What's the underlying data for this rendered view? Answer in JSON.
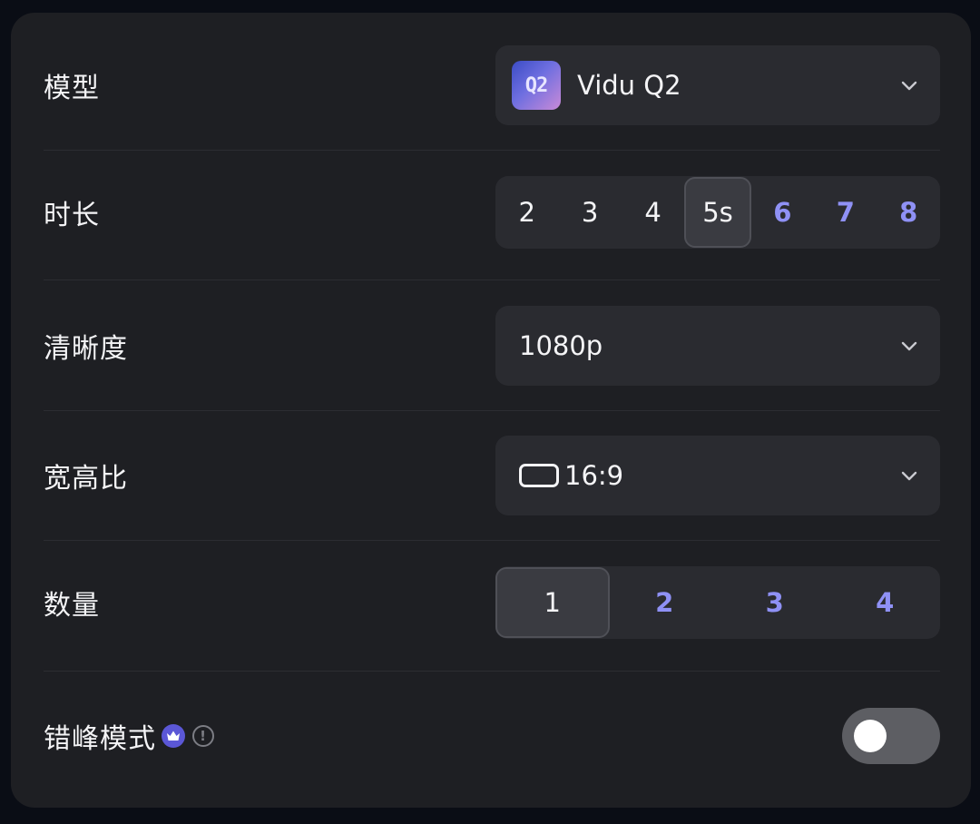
{
  "settings": {
    "model": {
      "label": "模型",
      "value": "Vidu Q2",
      "logo_text": "Q2"
    },
    "duration": {
      "label": "时长",
      "options": [
        "2",
        "3",
        "4",
        "5s",
        "6",
        "7",
        "8"
      ],
      "selected": "5s",
      "premium_options": [
        "6",
        "7",
        "8"
      ]
    },
    "resolution": {
      "label": "清晰度",
      "value": "1080p"
    },
    "aspect_ratio": {
      "label": "宽高比",
      "value": "16:9"
    },
    "quantity": {
      "label": "数量",
      "options": [
        "1",
        "2",
        "3",
        "4"
      ],
      "selected": "1",
      "premium_options": [
        "2",
        "3",
        "4"
      ]
    },
    "off_peak": {
      "label": "错峰模式",
      "info_glyph": "!",
      "enabled": false
    }
  },
  "icons": {
    "dropdown": "chevron-down-icon",
    "premium": "crown-icon",
    "info": "info-icon",
    "ratio": "rectangle-icon"
  },
  "colors": {
    "panel_bg": "#1e1f23",
    "control_bg": "#2a2b30",
    "premium_accent": "#8f91f5",
    "toggle_off": "#5d5e63"
  }
}
